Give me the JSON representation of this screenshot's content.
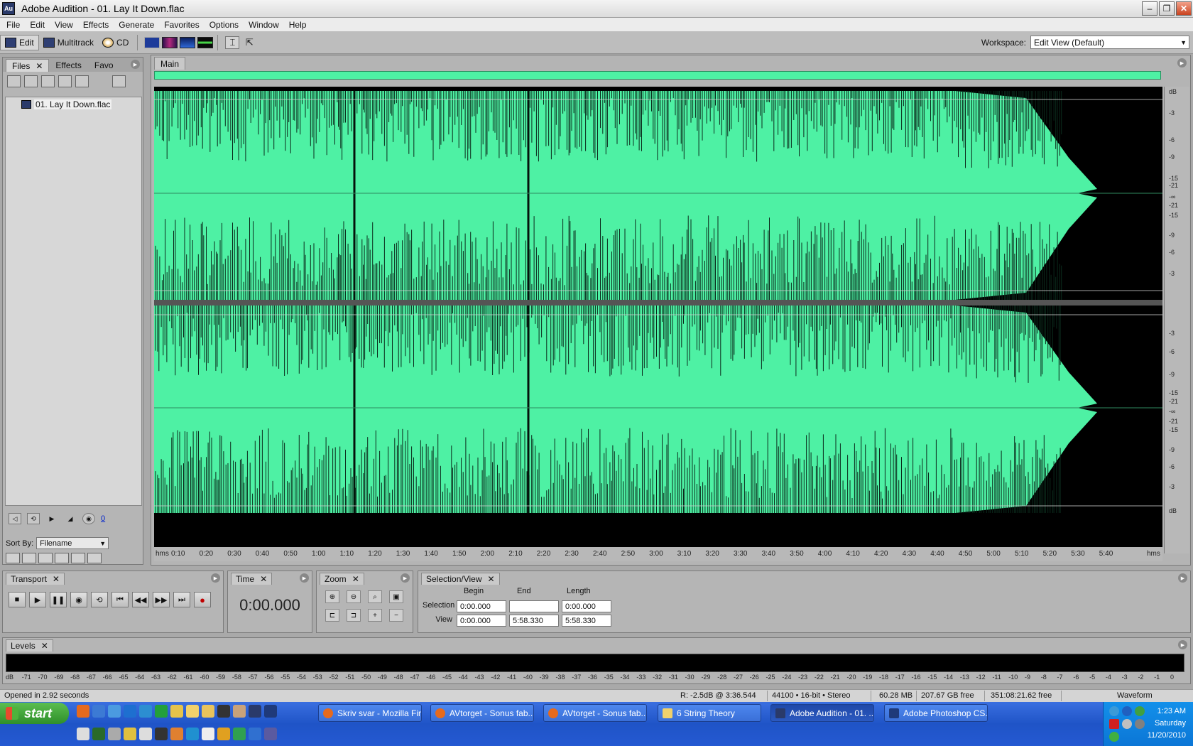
{
  "window": {
    "app_badge": "Au",
    "title": "Adobe Audition - 01. Lay It Down.flac"
  },
  "menu": [
    "File",
    "Edit",
    "View",
    "Effects",
    "Generate",
    "Favorites",
    "Options",
    "Window",
    "Help"
  ],
  "toolbar": {
    "edit_label": "Edit",
    "multitrack_label": "Multitrack",
    "cd_label": "CD",
    "workspace_label": "Workspace:",
    "workspace_value": "Edit View (Default)"
  },
  "files_panel": {
    "tabs": [
      "Files",
      "Effects",
      "Favo"
    ],
    "file_name": "01. Lay It Down.flac",
    "volume_value": "0",
    "sort_label": "Sort By:",
    "sort_value": "Filename"
  },
  "main_panel": {
    "tab": "Main",
    "db_top": [
      "dB",
      "-3",
      "-6",
      "-9",
      "-15",
      "-21",
      "-∞",
      "-21",
      "-15",
      "-9",
      "-6",
      "-3"
    ],
    "db_bottom": [
      "-3",
      "-6",
      "-9",
      "-15",
      "-21",
      "-∞",
      "-21",
      "-15",
      "-9",
      "-6",
      "-3",
      "dB"
    ],
    "time_ticks": [
      "hms",
      "0:10",
      "0:20",
      "0:30",
      "0:40",
      "0:50",
      "1:00",
      "1:10",
      "1:20",
      "1:30",
      "1:40",
      "1:50",
      "2:00",
      "2:10",
      "2:20",
      "2:30",
      "2:40",
      "2:50",
      "3:00",
      "3:10",
      "3:20",
      "3:30",
      "3:40",
      "3:50",
      "4:00",
      "4:10",
      "4:20",
      "4:30",
      "4:40",
      "4:50",
      "5:00",
      "5:10",
      "5:20",
      "5:30",
      "5:40",
      "hms"
    ],
    "wave_color": "#4ef1a4"
  },
  "transport": {
    "tab": "Transport"
  },
  "time_panel": {
    "tab": "Time",
    "value": "0:00.000"
  },
  "zoom_panel": {
    "tab": "Zoom"
  },
  "selection_view": {
    "tab": "Selection/View",
    "headers": [
      "Begin",
      "End",
      "Length"
    ],
    "selection_label": "Selection",
    "view_label": "View",
    "selection": [
      "0:00.000",
      "",
      "0:00.000"
    ],
    "view": [
      "0:00.000",
      "5:58.330",
      "5:58.330"
    ]
  },
  "levels": {
    "tab": "Levels",
    "scale": [
      "dB",
      "-71",
      "-70",
      "-69",
      "-68",
      "-67",
      "-66",
      "-65",
      "-64",
      "-63",
      "-62",
      "-61",
      "-60",
      "-59",
      "-58",
      "-57",
      "-56",
      "-55",
      "-54",
      "-53",
      "-52",
      "-51",
      "-50",
      "-49",
      "-48",
      "-47",
      "-46",
      "-45",
      "-44",
      "-43",
      "-42",
      "-41",
      "-40",
      "-39",
      "-38",
      "-37",
      "-36",
      "-35",
      "-34",
      "-33",
      "-32",
      "-31",
      "-30",
      "-29",
      "-28",
      "-27",
      "-26",
      "-25",
      "-24",
      "-23",
      "-22",
      "-21",
      "-20",
      "-19",
      "-18",
      "-17",
      "-16",
      "-15",
      "-14",
      "-13",
      "-12",
      "-11",
      "-10",
      "-9",
      "-8",
      "-7",
      "-6",
      "-5",
      "-4",
      "-3",
      "-2",
      "-1",
      "0"
    ]
  },
  "status": {
    "message": "Opened in 2.92 seconds",
    "cursor": "R: -2.5dB @  3:36.544",
    "format": "44100 • 16-bit • Stereo",
    "size": "60.28 MB",
    "free_space": "207.67 GB free",
    "free_time": "351:08:21.62 free",
    "view_mode": "Waveform"
  },
  "taskbar": {
    "start_label": "start",
    "tasks": [
      "Skriv svar - Mozilla Fir...",
      "AVtorget - Sonus fab...",
      "AVtorget - Sonus fab...",
      "6 String Theory",
      "Adobe Audition - 01. ...",
      "Adobe Photoshop CS..."
    ],
    "time": "1:23 AM",
    "day": "Saturday",
    "date": "11/20/2010"
  }
}
